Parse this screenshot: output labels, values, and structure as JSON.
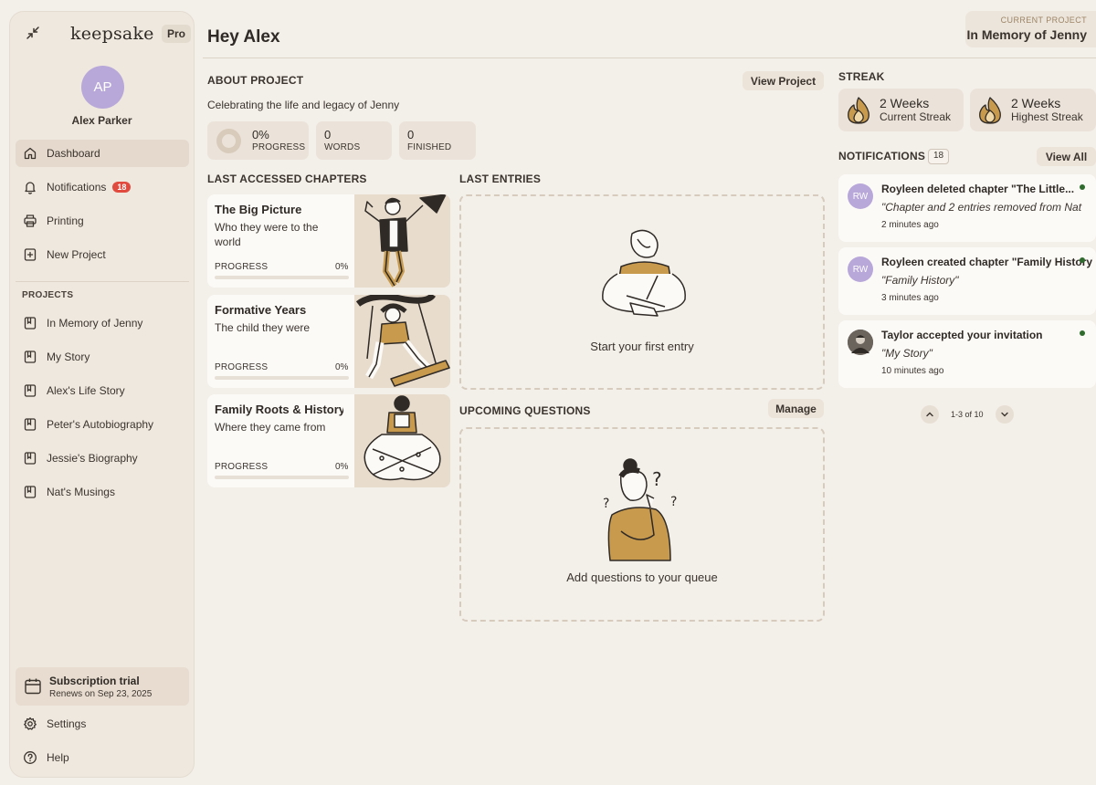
{
  "sidebar": {
    "brand": "keepsake",
    "plan_badge": "Pro",
    "user_initials": "AP",
    "user_name": "Alex Parker",
    "nav": [
      {
        "label": "Dashboard",
        "icon": "home-icon",
        "active": true
      },
      {
        "label": "Notifications",
        "icon": "bell-icon",
        "badge": "18"
      },
      {
        "label": "Printing",
        "icon": "printer-icon"
      },
      {
        "label": "New Project",
        "icon": "plus-square-icon"
      }
    ],
    "projects_label": "PROJECTS",
    "projects": [
      "In Memory of Jenny",
      "My Story",
      "Alex's Life Story",
      "Peter's Autobiography",
      "Jessie's Biography",
      "Nat's Musings"
    ],
    "subscription": {
      "title": "Subscription trial",
      "renews": "Renews on Sep 23, 2025"
    },
    "settings": "Settings",
    "help": "Help"
  },
  "header": {
    "greeting": "Hey Alex",
    "current_project_label": "CURRENT PROJECT",
    "current_project_name": "In Memory of Jenny"
  },
  "about": {
    "label": "ABOUT PROJECT",
    "view_button": "View Project",
    "description": "Celebrating the life and legacy of Jenny",
    "stats": {
      "progress_value": "0%",
      "progress_label": "PROGRESS",
      "words_value": "0",
      "words_label": "WORDS",
      "finished_value": "0",
      "finished_label": "FINISHED"
    }
  },
  "chapters": {
    "label": "LAST ACCESSED CHAPTERS",
    "progress_label": "PROGRESS",
    "items": [
      {
        "title": "The Big Picture",
        "subtitle": "Who they were to the world",
        "progress": "0%",
        "progress_fraction": 0
      },
      {
        "title": "Formative Years",
        "subtitle": "The child they were",
        "progress": "0%",
        "progress_fraction": 0
      },
      {
        "title": "Family Roots & History",
        "subtitle": "Where they came from",
        "progress": "0%",
        "progress_fraction": 0
      }
    ]
  },
  "entries": {
    "label": "LAST ENTRIES",
    "empty_text": "Start your first entry"
  },
  "questions": {
    "label": "UPCOMING QUESTIONS",
    "manage_button": "Manage",
    "empty_text": "Add questions to your queue"
  },
  "streak": {
    "label": "STREAK",
    "current_value": "2 Weeks",
    "current_label": "Current Streak",
    "highest_value": "2 Weeks",
    "highest_label": "Highest Streak"
  },
  "notifications": {
    "label": "NOTIFICATIONS",
    "count": "18",
    "view_all": "View All",
    "items": [
      {
        "initials": "RW",
        "title": "Royleen deleted chapter \"The Little...",
        "quote": "\"Chapter and 2 entries removed from Nat",
        "time": "2 minutes ago"
      },
      {
        "initials": "RW",
        "title": "Royleen created chapter \"Family History\"",
        "quote": "\"Family History\"",
        "time": "3 minutes ago"
      },
      {
        "initials": "",
        "title": "Taylor accepted your invitation",
        "quote": "\"My Story\"",
        "time": "10 minutes ago"
      }
    ],
    "pagination": "1-3 of 10"
  },
  "colors": {
    "background": "#f3efe9",
    "accent_gold": "#c79a4e",
    "avatar_purple": "#b8a7d9",
    "badge_red": "#e04a3f",
    "unread_dot": "#2e6b2c"
  }
}
